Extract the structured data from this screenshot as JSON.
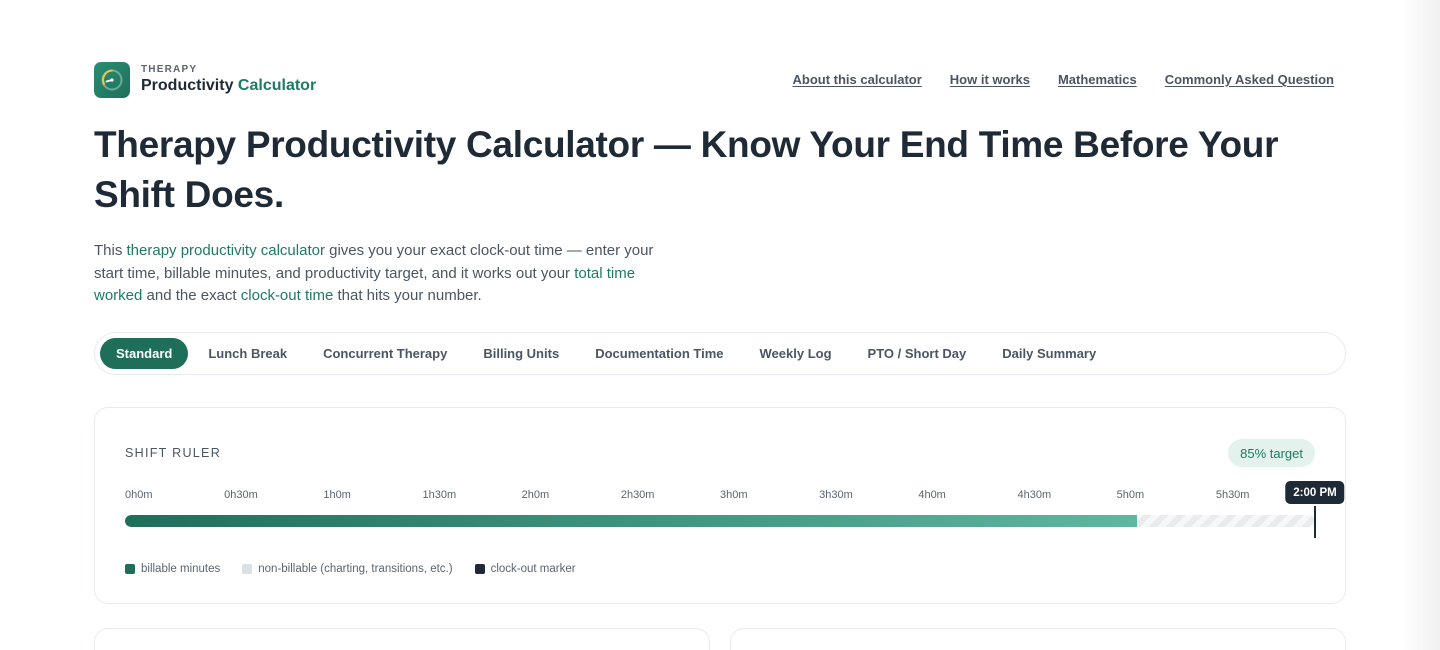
{
  "brand": {
    "kicker": "THERAPY",
    "name_main": "Productivity",
    "name_accent": "Calculator"
  },
  "nav": [
    {
      "label": "About this calculator"
    },
    {
      "label": "How it works"
    },
    {
      "label": "Mathematics"
    },
    {
      "label": "Commonly Asked Question"
    }
  ],
  "title": "Therapy Productivity Calculator — Know Your End Time Before Your Shift Does.",
  "intro": {
    "t1": "This ",
    "l1": "therapy productivity calculator",
    "t2": " gives you your exact clock-out time — enter your start time, billable minutes, and productivity target, and it works out your ",
    "l2": "total time worked",
    "t3": " and the exact ",
    "l3": "clock-out time",
    "t4": " that hits your number."
  },
  "tabs": [
    {
      "label": "Standard",
      "active": true
    },
    {
      "label": "Lunch Break"
    },
    {
      "label": "Concurrent Therapy"
    },
    {
      "label": "Billing Units"
    },
    {
      "label": "Documentation Time"
    },
    {
      "label": "Weekly Log"
    },
    {
      "label": "PTO / Short Day"
    },
    {
      "label": "Daily Summary"
    }
  ],
  "ruler": {
    "title": "SHIFT RULER",
    "target_badge": "85% target",
    "ticks": [
      "0h0m",
      "0h30m",
      "1h0m",
      "1h30m",
      "2h0m",
      "2h30m",
      "3h0m",
      "3h30m",
      "4h0m",
      "4h30m",
      "5h0m",
      "5h30m"
    ],
    "tick_minutes": [
      0,
      30,
      60,
      90,
      120,
      150,
      180,
      210,
      240,
      270,
      300,
      330
    ],
    "scale_max_minutes": 360,
    "billable_minutes": 306,
    "clock_out_minutes": 360,
    "clock_out_label": "2:00 PM",
    "legend": [
      {
        "label": "billable minutes",
        "color": "#1f6e5a"
      },
      {
        "label": "non-billable (charting, transitions, etc.)",
        "color": "#dcdfe3"
      },
      {
        "label": "clock-out marker",
        "color": "#1f2a37"
      }
    ]
  },
  "colors": {
    "accent": "#1f7a63",
    "accent_dark": "#1f6e5a",
    "text": "#1f2a37"
  }
}
